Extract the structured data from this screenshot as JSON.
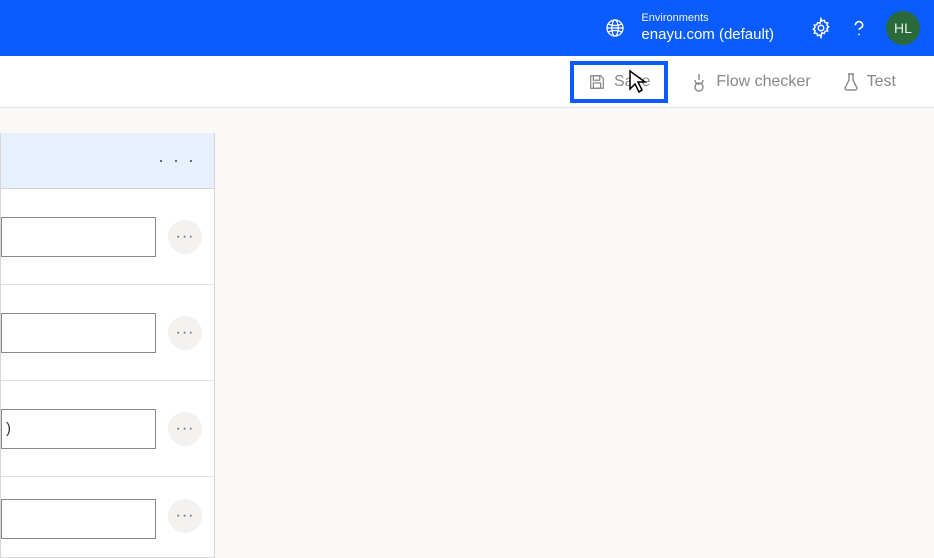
{
  "header": {
    "env_label": "Environments",
    "env_value": "enayu.com (default)",
    "avatar": "HL"
  },
  "toolbar": {
    "save_label": "Save",
    "flow_checker_label": "Flow checker",
    "test_label": "Test"
  },
  "card": {
    "header_dots": "· · ·",
    "rows": [
      {
        "value": "",
        "more": "···"
      },
      {
        "value": "",
        "more": "···"
      },
      {
        "value": ")",
        "more": "···"
      },
      {
        "value": "",
        "more": "···"
      }
    ]
  }
}
